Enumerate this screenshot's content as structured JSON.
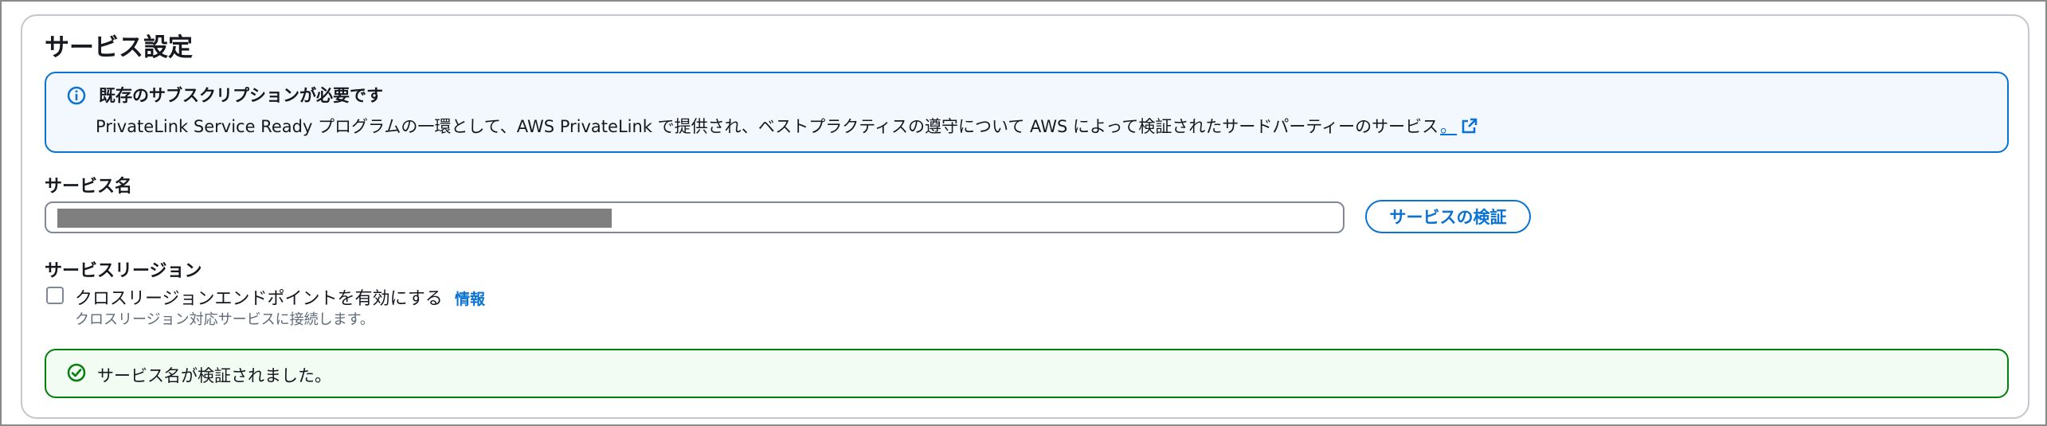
{
  "section": {
    "title": "サービス設定"
  },
  "info_alert": {
    "icon": "info-icon",
    "title": "既存のサブスクリプションが必要です",
    "body": "PrivateLink Service Ready プログラムの一環として、AWS PrivateLink で提供され、ベストプラクティスの遵守について AWS によって検証されたサードパーティーのサービス",
    "link_text": "。",
    "link_icon": "external-link-icon",
    "color": "#0972d3"
  },
  "service_name": {
    "label": "サービス名",
    "value_redacted": true,
    "verify_button": "サービスの検証"
  },
  "service_region": {
    "label": "サービスリージョン",
    "checkbox_label": "クロスリージョンエンドポイントを有効にする",
    "checked": false,
    "info_link": "情報",
    "description": "クロスリージョン対応サービスに接続します。"
  },
  "success_alert": {
    "icon": "check-circle-icon",
    "text": "サービス名が検証されました。",
    "color": "#037f0c"
  }
}
